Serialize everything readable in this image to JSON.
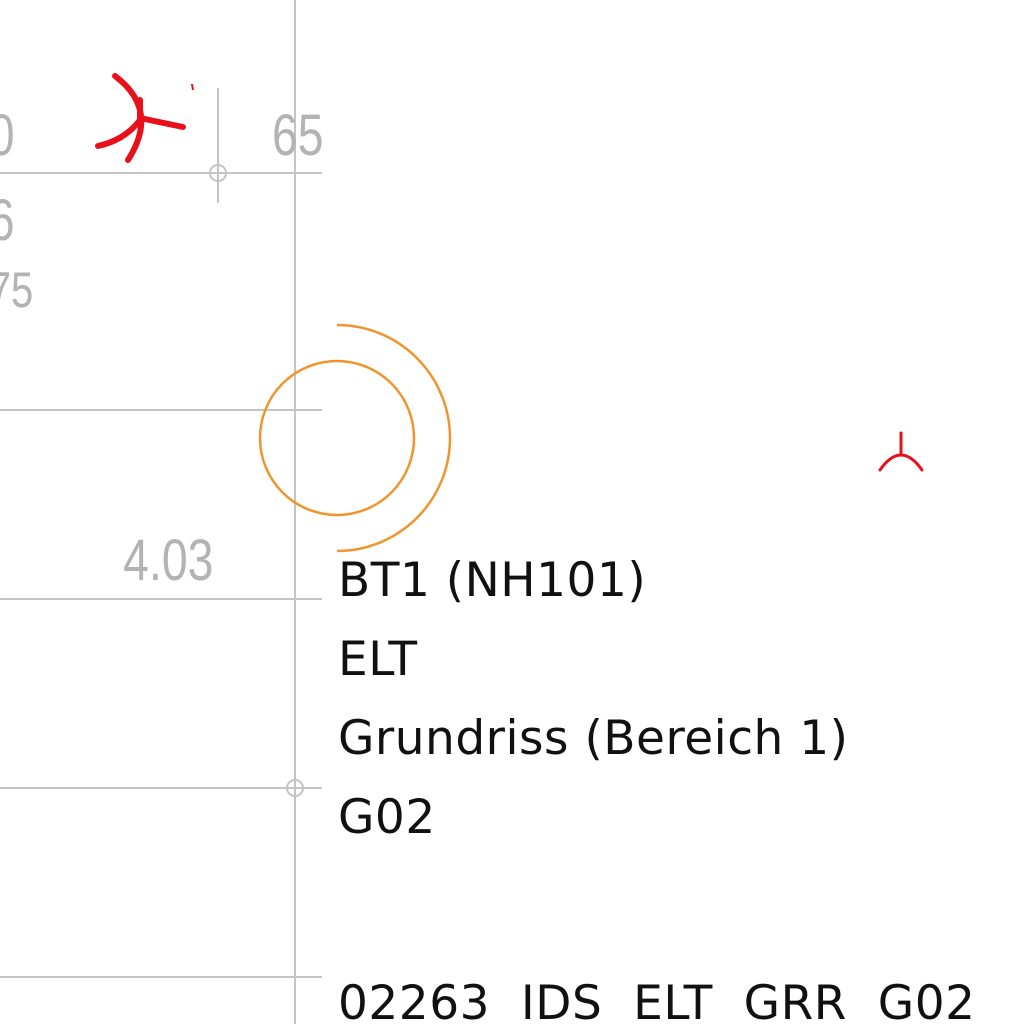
{
  "drawing": {
    "dimension_fragments": {
      "top_left_partial": "0",
      "mid_left_partial": "6",
      "lower_left_partial": "75"
    },
    "dimensions": {
      "top_right": "65",
      "middle": "4.03"
    }
  },
  "title_block": {
    "line_1": "BT1 (NH101)",
    "line_2": "ELT",
    "line_3": "Grundriss (Bereich 1)",
    "line_4": "G02",
    "line_5": "02263  IDS  ELT  GRR  G02"
  },
  "colors": {
    "line": "#c4c4c4",
    "dimension_text": "#b3b3b3",
    "symbol_red": "#e8101a",
    "circle_orange": "#f0952e",
    "text": "#111111"
  }
}
